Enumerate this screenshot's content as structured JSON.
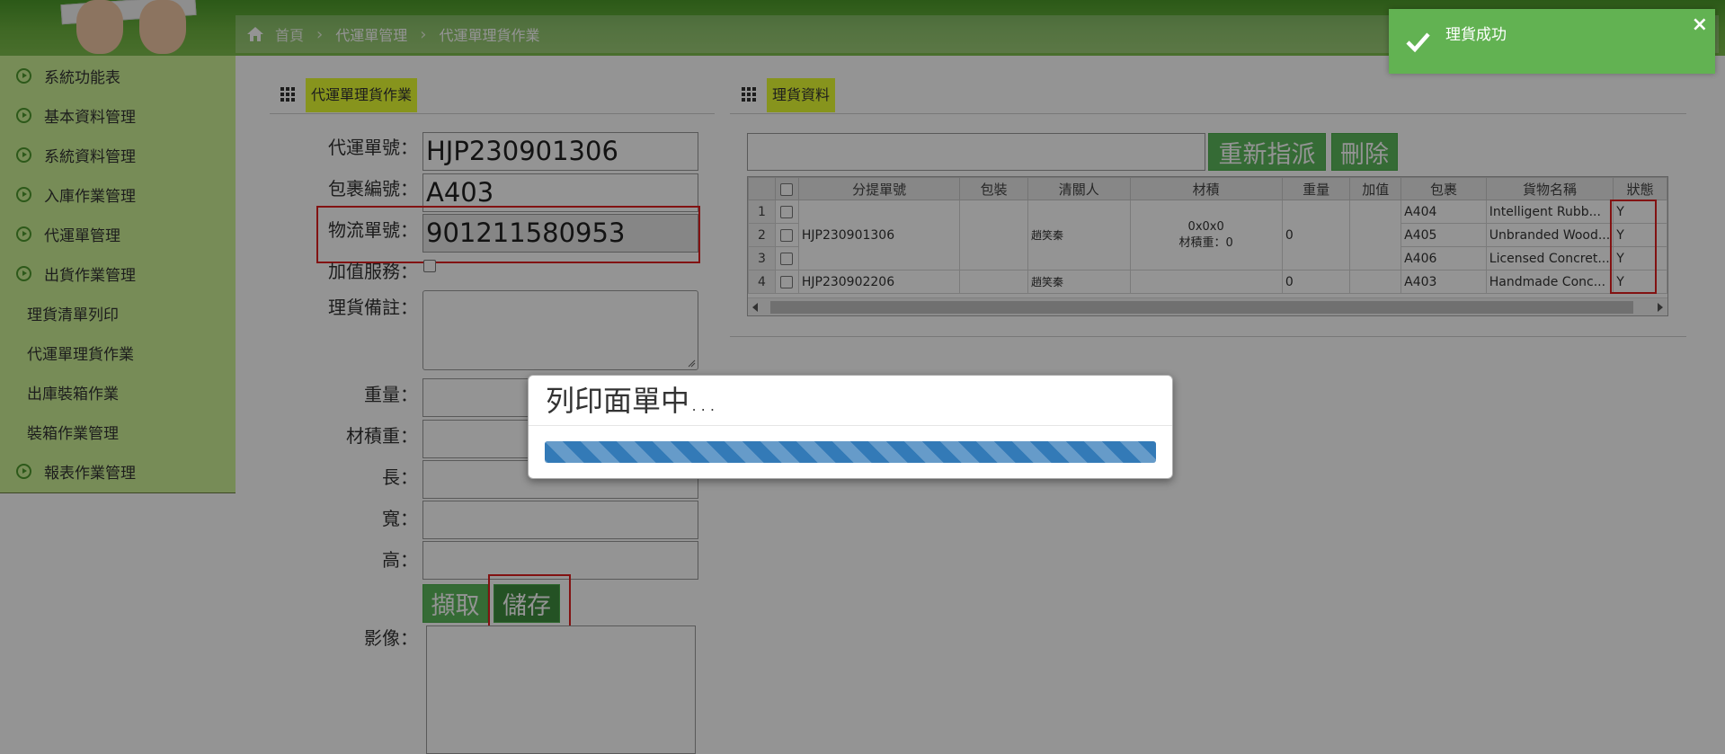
{
  "breadcrumb": {
    "home": "首頁",
    "level1": "代運單管理",
    "level2": "代運單理貨作業"
  },
  "sidebar": {
    "items": [
      {
        "label": "系統功能表"
      },
      {
        "label": "基本資料管理"
      },
      {
        "label": "系統資料管理"
      },
      {
        "label": "入庫作業管理"
      },
      {
        "label": "代運單管理"
      },
      {
        "label": "出貨作業管理"
      }
    ],
    "subitems": [
      {
        "label": "理貨清單列印"
      },
      {
        "label": "代運單理貨作業"
      },
      {
        "label": "出庫裝箱作業"
      },
      {
        "label": "裝箱作業管理"
      }
    ],
    "last_item": {
      "label": "報表作業管理"
    }
  },
  "form_panel": {
    "title": "代運單理貨作業",
    "labels": {
      "waybill": "代運單號：",
      "package": "包裹編號：",
      "logistics": "物流單號：",
      "value_added": "加值服務：",
      "remark": "理貨備註：",
      "weight": "重量：",
      "volume_weight": "材積重：",
      "length": "長：",
      "width": "寬：",
      "height": "高：",
      "image": "影像："
    },
    "values": {
      "waybill": "HJP230901306",
      "package": "A403",
      "logistics": "901211580953"
    },
    "buttons": {
      "capture": "擷取",
      "save": "儲存"
    }
  },
  "data_panel": {
    "title": "理貨資料",
    "buttons": {
      "reassign": "重新指派",
      "delete": "刪除"
    },
    "columns": [
      "分提單號",
      "包裝",
      "清關人",
      "材積",
      "重量",
      "加值",
      "包裹",
      "貨物名稱",
      "狀態"
    ],
    "rows": [
      {
        "rn": "1",
        "package": "A404",
        "goods": "Intelligent Rubb...",
        "status": "Y"
      },
      {
        "rn": "2",
        "package": "A405",
        "goods": "Unbranded Wood...",
        "status": "Y"
      },
      {
        "rn": "3",
        "package": "A406",
        "goods": "Licensed Concret...",
        "status": "Y"
      },
      {
        "rn": "4",
        "package": "A403",
        "goods": "Handmade Conc...",
        "status": "Y"
      }
    ],
    "group1": {
      "bill": "HJP230901306",
      "customs": "趙笑秦",
      "volume": "0x0x0",
      "volume_weight": "材積重：0",
      "weight": "0"
    },
    "group2": {
      "bill": "HJP230902206",
      "customs": "趙笑秦",
      "weight": "0"
    }
  },
  "modal": {
    "title": "列印面單中...",
    "progress": 1.0
  },
  "toast": {
    "message": "理貨成功",
    "close": "×"
  },
  "colors": {
    "sidebar": "#cdf296",
    "panel_title_bg": "#e9ff33",
    "button_green": "#5cb85c",
    "toast": "#62b252",
    "progress": "#337ab7"
  }
}
